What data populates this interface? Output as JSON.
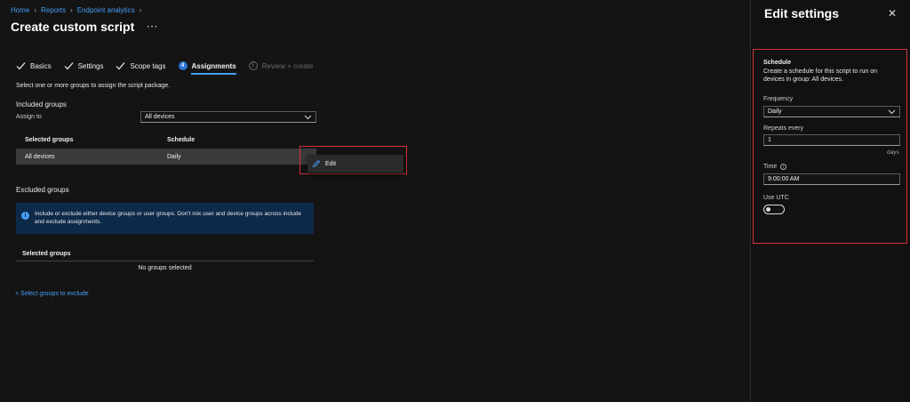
{
  "breadcrumb": {
    "items": [
      "Home",
      "Reports",
      "Endpoint analytics"
    ]
  },
  "page": {
    "title": "Create custom script",
    "more": "···"
  },
  "steps": [
    {
      "label": "Basics",
      "state": "done"
    },
    {
      "label": "Settings",
      "state": "done"
    },
    {
      "label": "Scope tags",
      "state": "done"
    },
    {
      "label": "Assignments",
      "state": "active",
      "num": "4"
    },
    {
      "label": "Review + create",
      "state": "disabled",
      "num": "5"
    }
  ],
  "assignments": {
    "description": "Select one or more groups to assign the script package.",
    "included_heading": "Included groups",
    "assign_to_label": "Assign to",
    "assign_to_value": "All devices",
    "table": {
      "headers": [
        "Selected groups",
        "Schedule"
      ],
      "rows": [
        {
          "group": "All devices",
          "schedule": "Daily"
        }
      ]
    },
    "context_menu": {
      "edit_label": "Edit"
    },
    "excluded_heading": "Excluded groups",
    "info_text": "Include or exclude either device groups or user groups. Don't mix user and device groups across include and exclude assignments.",
    "excluded_table_header": "Selected groups",
    "excluded_empty": "No groups selected",
    "exclude_link": "+ Select groups to exclude"
  },
  "panel": {
    "title": "Edit settings",
    "close": "✕",
    "schedule_title": "Schedule",
    "schedule_desc": "Create a schedule for this script to run on devices in group: All devices.",
    "frequency_label": "Frequency",
    "frequency_value": "Daily",
    "repeats_label": "Repeats every",
    "repeats_value": "1",
    "repeats_unit": "days",
    "time_label": "Time",
    "time_value": "9:00:00 AM",
    "utc_label": "Use UTC",
    "utc_on": false
  },
  "colors": {
    "accent": "#479ef5",
    "highlight": "#d13438",
    "info_bg": "#0e2a4a"
  }
}
